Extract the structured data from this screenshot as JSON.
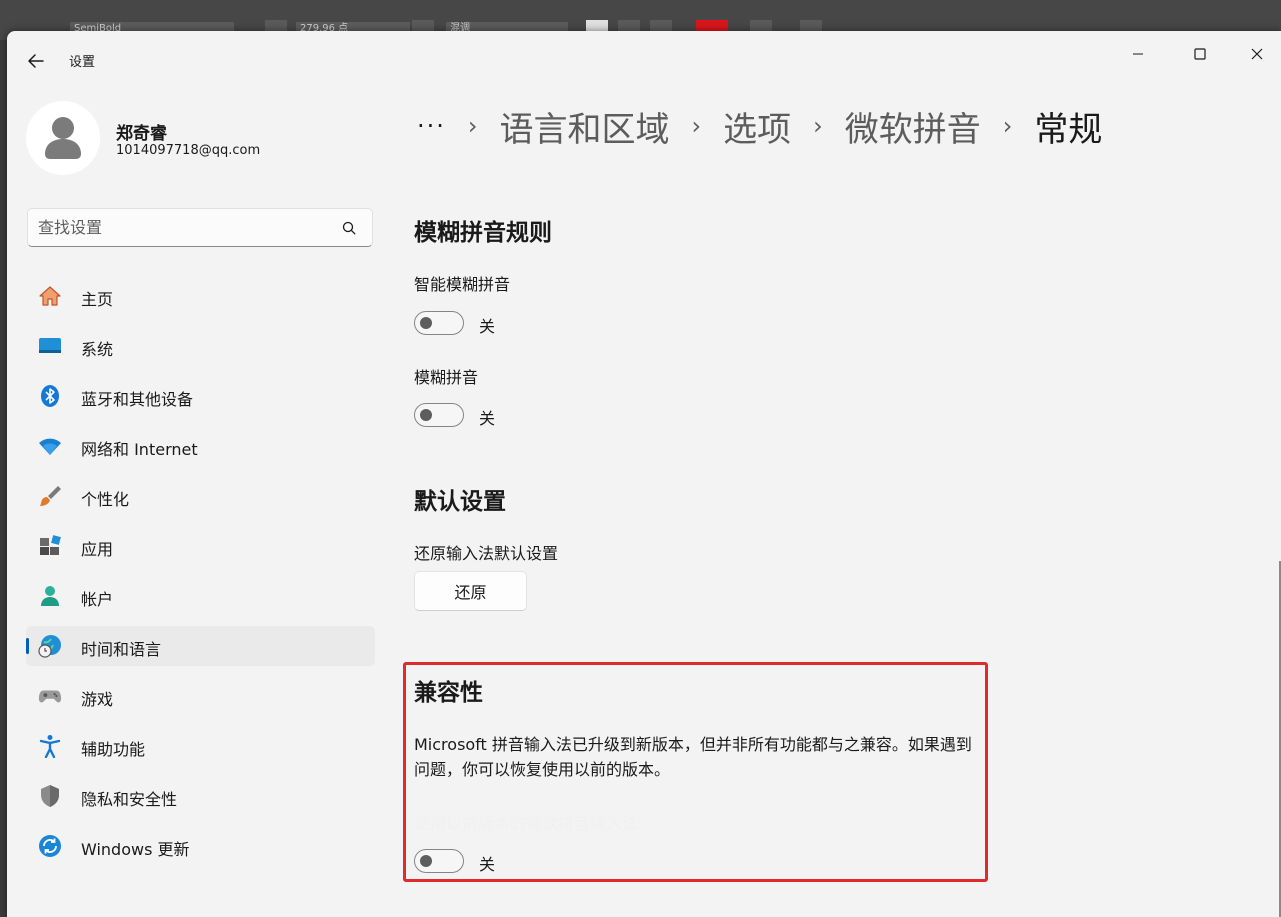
{
  "background_app": {
    "font_field": "SemiBold",
    "size_field": "279.96 点",
    "mode_field": "混调"
  },
  "window": {
    "title": "设置"
  },
  "user": {
    "name": "郑奇睿",
    "email": "1014097718@qq.com"
  },
  "search": {
    "placeholder": "查找设置"
  },
  "sidebar": {
    "items": [
      {
        "label": "主页",
        "icon": "home-icon"
      },
      {
        "label": "系统",
        "icon": "system-icon"
      },
      {
        "label": "蓝牙和其他设备",
        "icon": "bluetooth-icon"
      },
      {
        "label": "网络和 Internet",
        "icon": "wifi-icon"
      },
      {
        "label": "个性化",
        "icon": "brush-icon"
      },
      {
        "label": "应用",
        "icon": "apps-icon"
      },
      {
        "label": "帐户",
        "icon": "account-icon"
      },
      {
        "label": "时间和语言",
        "icon": "time-language-icon",
        "selected": true
      },
      {
        "label": "游戏",
        "icon": "gamepad-icon"
      },
      {
        "label": "辅助功能",
        "icon": "accessibility-icon"
      },
      {
        "label": "隐私和安全性",
        "icon": "shield-icon"
      },
      {
        "label": "Windows 更新",
        "icon": "update-icon"
      }
    ]
  },
  "breadcrumb": {
    "overflow": "···",
    "items": [
      "语言和区域",
      "选项",
      "微软拼音"
    ],
    "current": "常规"
  },
  "fuzzy": {
    "heading": "模糊拼音规则",
    "smart_label": "智能模糊拼音",
    "smart_state": "关",
    "fuzzy_label": "模糊拼音",
    "fuzzy_state": "关"
  },
  "defaults": {
    "heading": "默认设置",
    "restore_label": "还原输入法默认设置",
    "restore_button": "还原"
  },
  "compat": {
    "heading": "兼容性",
    "description": "Microsoft 拼音输入法已升级到新版本，但并非所有功能都与之兼容。如果遇到问题，你可以恢复使用以前的版本。",
    "previous_label": "使用以前版本的微软拼音输入法",
    "previous_state": "关"
  },
  "colors": {
    "accent": "#005fb8",
    "highlight_border": "#de2b2b",
    "window_bg": "#f3f3f3"
  }
}
